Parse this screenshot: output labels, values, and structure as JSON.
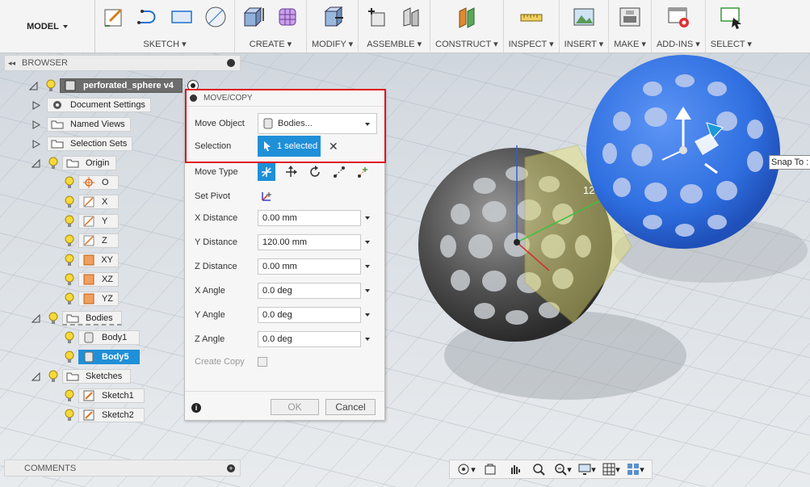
{
  "toolbar": {
    "workspace": "MODEL",
    "groups": [
      {
        "label": "SKETCH",
        "icons": [
          "create-sketch-icon",
          "line-icon",
          "rectangle-icon",
          "circle-icon"
        ]
      },
      {
        "label": "CREATE",
        "icons": [
          "extrude-icon",
          "form-icon"
        ]
      },
      {
        "label": "MODIFY",
        "icons": [
          "press-pull-icon"
        ]
      },
      {
        "label": "ASSEMBLE",
        "icons": [
          "new-component-icon",
          "joint-icon"
        ]
      },
      {
        "label": "CONSTRUCT",
        "icons": [
          "offset-plane-icon"
        ]
      },
      {
        "label": "INSPECT",
        "icons": [
          "measure-icon"
        ]
      },
      {
        "label": "INSERT",
        "icons": [
          "insert-image-icon"
        ]
      },
      {
        "label": "MAKE",
        "icons": [
          "3d-print-icon"
        ]
      },
      {
        "label": "ADD-INS",
        "icons": [
          "scripts-icon"
        ]
      },
      {
        "label": "SELECT",
        "icons": [
          "select-icon"
        ]
      }
    ]
  },
  "browser": {
    "title": "BROWSER",
    "root": "perforated_sphere v4",
    "document_settings": "Document Settings",
    "named_views": "Named Views",
    "selection_sets": "Selection Sets",
    "origin": "Origin",
    "origin_items": [
      "O",
      "X",
      "Y",
      "Z",
      "XY",
      "XZ",
      "YZ"
    ],
    "bodies": "Bodies",
    "body_items": [
      "Body1",
      "Body5"
    ],
    "sketches": "Sketches",
    "sketch_items": [
      "Sketch1",
      "Sketch2"
    ]
  },
  "dialog": {
    "title": "MOVE/COPY",
    "move_object_label": "Move Object",
    "move_object_value": "Bodies...",
    "selection_label": "Selection",
    "selection_value": "1 selected",
    "move_type_label": "Move Type",
    "set_pivot_label": "Set Pivot",
    "x_distance_label": "X Distance",
    "x_distance": "0.00 mm",
    "y_distance_label": "Y Distance",
    "y_distance": "120.00 mm",
    "z_distance_label": "Z Distance",
    "z_distance": "0.00 mm",
    "x_angle_label": "X Angle",
    "x_angle": "0.0 deg",
    "y_angle_label": "Y Angle",
    "y_angle": "0.0 deg",
    "z_angle_label": "Z Angle",
    "z_angle": "0.0 deg",
    "create_copy_label": "Create Copy",
    "ok": "OK",
    "cancel": "Cancel"
  },
  "viewport": {
    "dimension_label": "120.00",
    "snap_label": "Snap To :"
  },
  "comments": {
    "title": "COMMENTS"
  },
  "colors": {
    "accent": "#1f8fd8",
    "highlight_box": "#e0141e",
    "blue_sphere": "#2f6fe0",
    "dark_sphere": "#4a4a4a"
  }
}
